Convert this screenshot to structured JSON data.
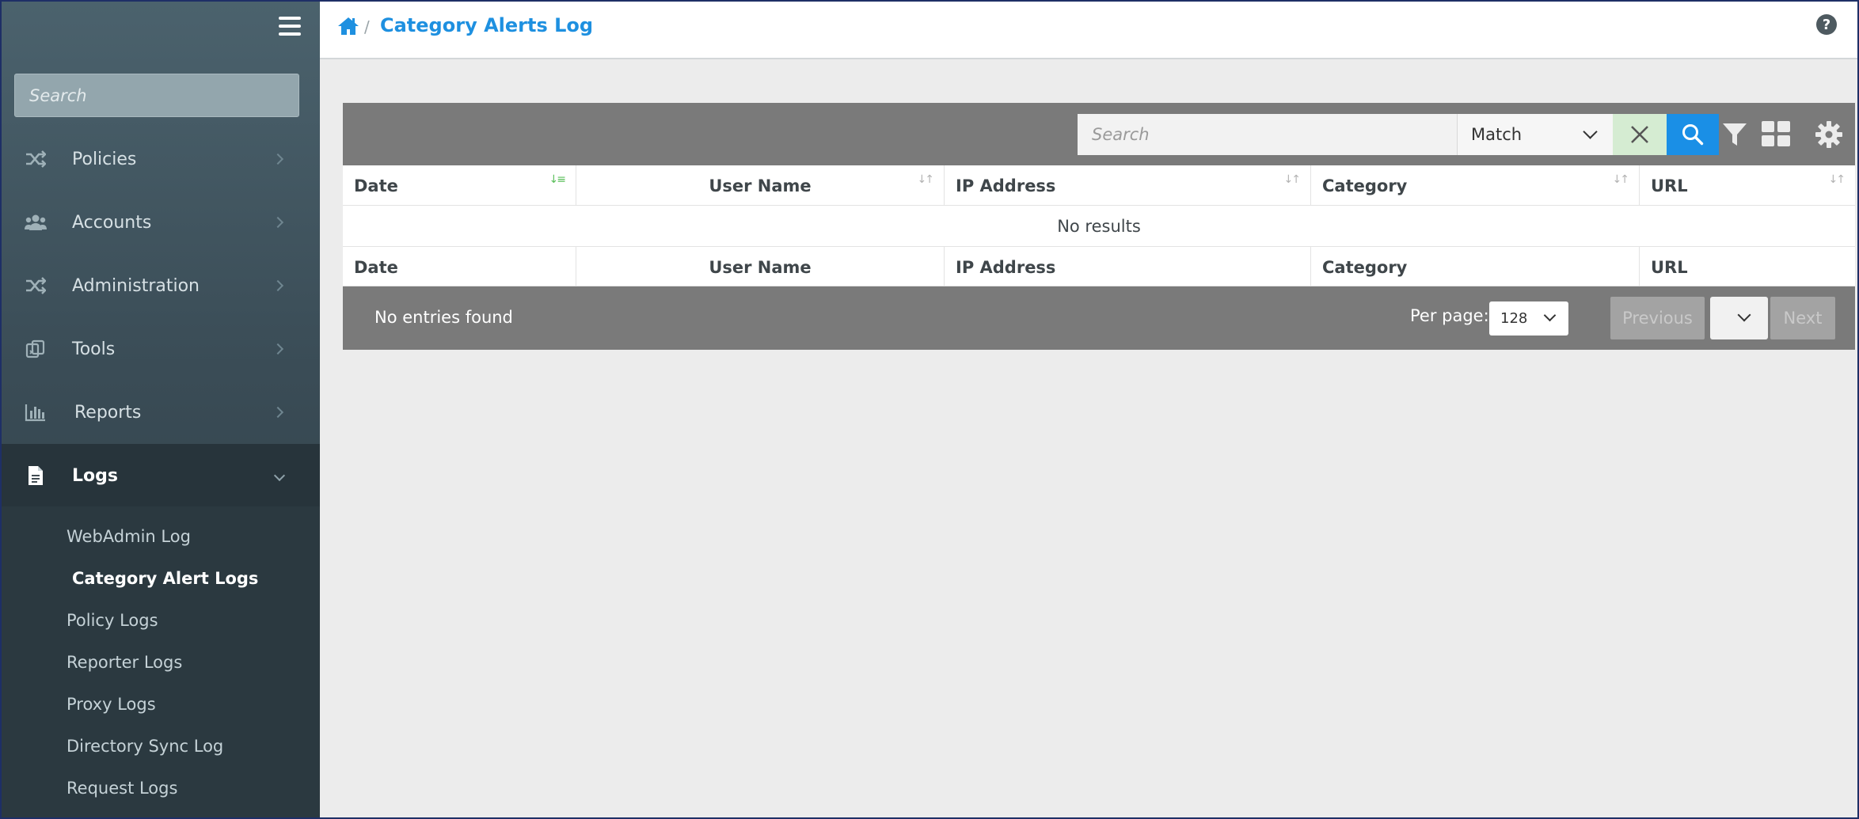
{
  "sidebar": {
    "search_placeholder": "Search",
    "items": [
      {
        "label": "Policies",
        "icon": "shuffle-icon"
      },
      {
        "label": "Accounts",
        "icon": "users-icon"
      },
      {
        "label": "Administration",
        "icon": "shuffle-icon"
      },
      {
        "label": "Tools",
        "icon": "tools-icon"
      },
      {
        "label": "Reports",
        "icon": "bar-chart-icon"
      },
      {
        "label": "Logs",
        "icon": "document-icon",
        "active": true
      }
    ],
    "logs_subitems": [
      {
        "label": "WebAdmin Log"
      },
      {
        "label": "Category Alert Logs",
        "active": true
      },
      {
        "label": "Policy Logs"
      },
      {
        "label": "Reporter Logs"
      },
      {
        "label": "Proxy Logs"
      },
      {
        "label": "Directory Sync Log"
      },
      {
        "label": "Request Logs"
      }
    ]
  },
  "header": {
    "separator": "/",
    "title": "Category Alerts Log",
    "help_glyph": "?"
  },
  "grid": {
    "search_placeholder": "Search",
    "match_value": "Match",
    "columns": [
      "Date",
      "User Name",
      "IP Address",
      "Category",
      "URL"
    ],
    "empty_message": "No results",
    "footer": {
      "entries_text": "No entries found",
      "per_page_label": "Per page:",
      "per_page_value": "128",
      "previous_label": "Previous",
      "next_label": "Next"
    }
  },
  "colors": {
    "accent_blue": "#1a8fe6",
    "title_blue": "#1e90e0",
    "toolbar_gray": "#7a7a7a",
    "clear_green": "#d5ecd2",
    "sort_active": "#5bbf5b"
  }
}
